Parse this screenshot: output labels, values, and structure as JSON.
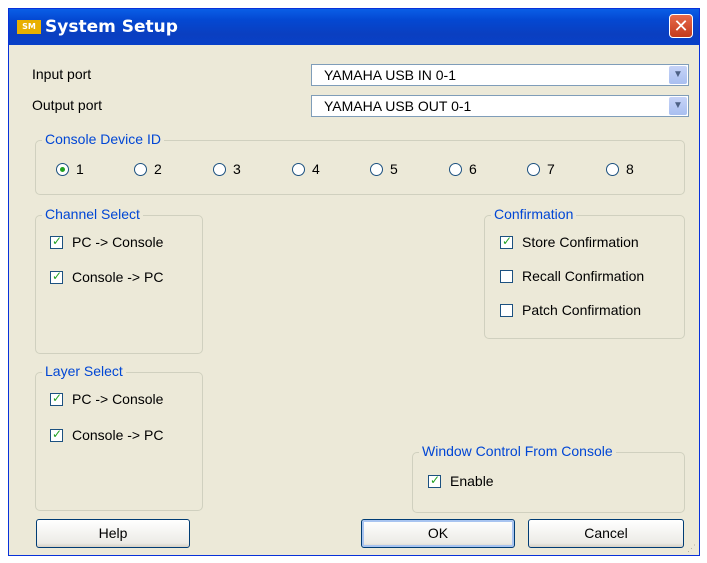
{
  "window": {
    "title": "System Setup",
    "icon_text": "SM",
    "close_glyph": "✕"
  },
  "ports": {
    "input_label": "Input port",
    "input_value": "YAMAHA USB IN 0-1",
    "output_label": "Output port",
    "output_value": "YAMAHA USB OUT 0-1"
  },
  "console_device": {
    "title": "Console Device ID",
    "options": [
      "1",
      "2",
      "3",
      "4",
      "5",
      "6",
      "7",
      "8"
    ],
    "selected": "1"
  },
  "channel_select": {
    "title": "Channel Select",
    "items": [
      {
        "label": "PC -> Console",
        "checked": true
      },
      {
        "label": "Console -> PC",
        "checked": true
      }
    ]
  },
  "confirmation": {
    "title": "Confirmation",
    "items": [
      {
        "label": "Store Confirmation",
        "checked": true
      },
      {
        "label": "Recall Confirmation",
        "checked": false
      },
      {
        "label": "Patch Confirmation",
        "checked": false
      }
    ]
  },
  "layer_select": {
    "title": "Layer Select",
    "items": [
      {
        "label": "PC -> Console",
        "checked": true
      },
      {
        "label": "Console -> PC",
        "checked": true
      }
    ]
  },
  "window_control": {
    "title": "Window Control From Console",
    "items": [
      {
        "label": "Enable",
        "checked": true
      }
    ]
  },
  "buttons": {
    "help": "Help",
    "ok": "OK",
    "cancel": "Cancel"
  },
  "colors": {
    "titlebar": "#0a47d0",
    "group_title": "#0046d5",
    "check_green": "#21a121",
    "dialog_bg": "#ece9d8"
  }
}
